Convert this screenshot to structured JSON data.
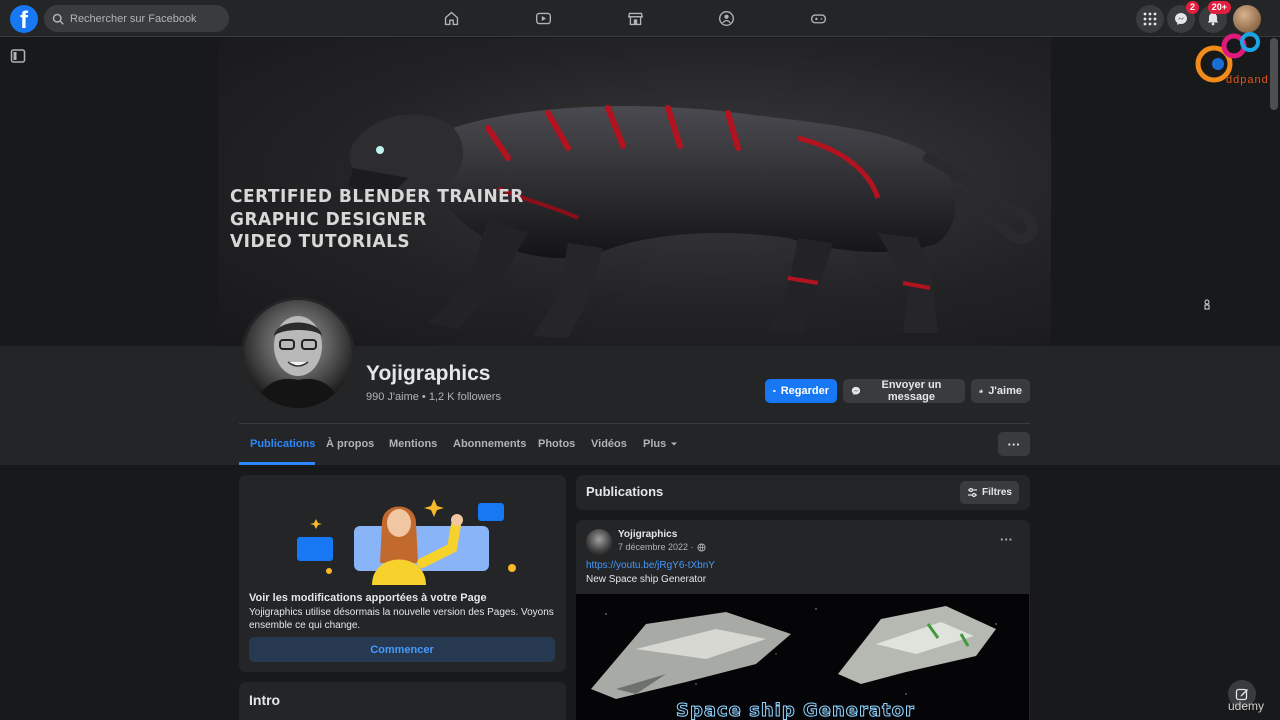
{
  "topbar": {
    "logo": "f",
    "search_placeholder": "Rechercher sur Facebook",
    "nav_icons": [
      "home-icon",
      "video-icon",
      "marketplace-icon",
      "groups-icon",
      "gaming-icon"
    ],
    "messenger_badge": "2",
    "notifications_badge": "20+"
  },
  "watermark": {
    "text": "ddpand"
  },
  "cover": {
    "lines": [
      "CERTIFIED BLENDER TRAINER",
      "GRAPHIC DESIGNER",
      "VIDEO TUTORIALS"
    ]
  },
  "profile": {
    "name": "Yojigraphics",
    "stats": "990 J'aime • 1,2 K followers",
    "buttons": {
      "watch": "Regarder",
      "message": "Envoyer un message",
      "like": "J'aime"
    }
  },
  "tabs": [
    "Publications",
    "À propos",
    "Mentions",
    "Abonnements",
    "Photos",
    "Vidéos",
    "Plus"
  ],
  "tabs_more_label": "···",
  "promo": {
    "title": "Voir les modifications apportées à votre Page",
    "text": "Yojigraphics utilise désormais la nouvelle version des Pages. Voyons ensemble ce qui change.",
    "button": "Commencer"
  },
  "intro": {
    "title": "Intro"
  },
  "publications": {
    "title": "Publications",
    "filter": "Filtres"
  },
  "post": {
    "author": "Yojigraphics",
    "date": "7 décembre 2022 ·",
    "menu": "···",
    "link": "https://youtu.be/jRgY6-tXbnY",
    "text": "New Space ship Generator",
    "image_title": "Space ship Generator"
  },
  "footer": {
    "brand": "udemy"
  },
  "colors": {
    "accent": "#1877f2",
    "background": "#18191a",
    "surface": "#242526"
  }
}
